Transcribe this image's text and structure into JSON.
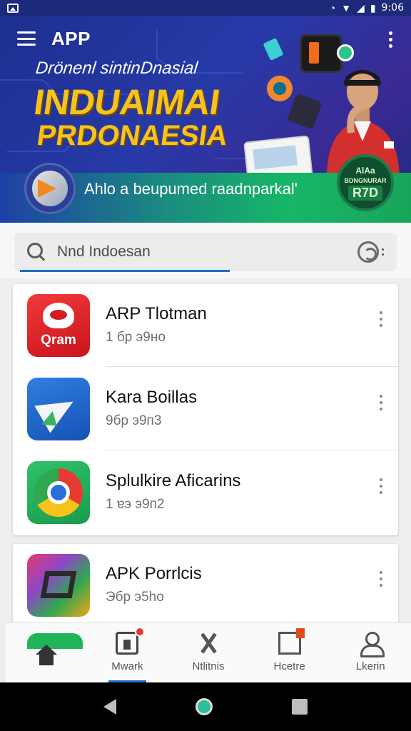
{
  "status_bar": {
    "time": "9:06"
  },
  "header": {
    "title": "APP"
  },
  "banner": {
    "subtitle": "Drönenl sintinDnasial",
    "headline_1": "INDUAIMAI",
    "headline_2": "PRDONAESIA",
    "strip_text": "Ahlo a beupumed raadnparkal'",
    "badge": {
      "line1": "AlAa",
      "line2": "BDNGNURAR",
      "line3": "R7D"
    }
  },
  "search": {
    "placeholder": "Nnd Indoesan"
  },
  "apps": [
    {
      "name": "ARP Tlotman",
      "meta": "1 бр э9но",
      "icon_label": "Qram",
      "icon": "red-app-icon"
    },
    {
      "name": "Kara Boillas",
      "meta": "9бр э9п3",
      "icon_label": "",
      "icon": "paper-plane-icon"
    },
    {
      "name": "Splulkire Aficarins",
      "meta": "1 ɐэ э9п2",
      "icon_label": "",
      "icon": "chrome-icon"
    },
    {
      "name": "APK Porrlcis",
      "meta": "Эбр э5ho",
      "icon_label": "",
      "icon": "colorful-square-icon"
    }
  ],
  "bottom_nav": [
    {
      "label": "",
      "icon": "home-icon"
    },
    {
      "label": "Mwark",
      "icon": "work-icon"
    },
    {
      "label": "Ntlitnis",
      "icon": "x-icon"
    },
    {
      "label": "Hcetre",
      "icon": "flag-icon"
    },
    {
      "label": "Lkerin",
      "icon": "user-icon"
    }
  ],
  "colors": {
    "accent": "#1e6fc8",
    "banner": "#273aa8",
    "headline": "#f6c21c",
    "strip_green": "#17b667"
  }
}
